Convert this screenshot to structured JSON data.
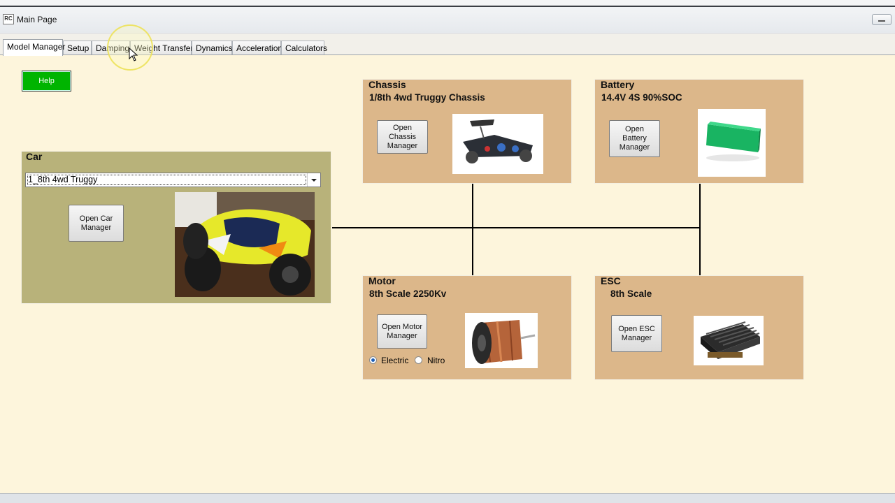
{
  "window": {
    "app_icon_text": "RC",
    "title": "Main Page"
  },
  "tabs": [
    {
      "label": "Model Manager",
      "active": true
    },
    {
      "label": "Setup",
      "active": false
    },
    {
      "label": "Damping",
      "active": false
    },
    {
      "label": "Weight Transfer",
      "active": false
    },
    {
      "label": "Dynamics",
      "active": false
    },
    {
      "label": "Acceleration",
      "active": false
    },
    {
      "label": "Calculators",
      "active": false
    }
  ],
  "help_label": "Help",
  "car": {
    "title": "Car",
    "selected_model": "1_8th 4wd Truggy",
    "open_button": "Open Car Manager",
    "photo_icon": "truggy-photo"
  },
  "chassis": {
    "title": "Chassis",
    "subtitle": "1/8th 4wd Truggy Chassis",
    "open_button": "Open Chassis Manager",
    "photo_icon": "chassis-photo"
  },
  "battery": {
    "title": "Battery",
    "subtitle": "14.4V 4S 90%SOC",
    "open_button": "Open Battery Manager",
    "photo_icon": "battery-pack-photo"
  },
  "motor": {
    "title": "Motor",
    "subtitle": "8th Scale 2250Kv",
    "open_button": "Open Motor Manager",
    "radio_electric": "Electric",
    "radio_nitro": "Nitro",
    "selected_type": "Electric",
    "photo_icon": "brushless-motor-photo"
  },
  "esc": {
    "title": "ESC",
    "subtitle": "8th Scale",
    "open_button": "Open ESC Manager",
    "photo_icon": "esc-heatsink-photo"
  },
  "colors": {
    "content_bg": "#fdf5dc",
    "car_panel": "#b8b27a",
    "component_panel": "#dcb78a",
    "help_button": "#00b400"
  }
}
